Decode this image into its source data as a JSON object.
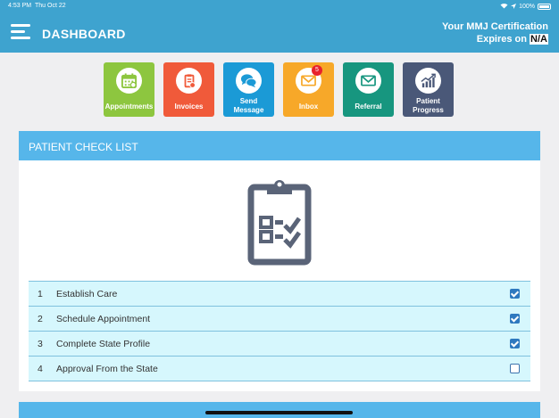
{
  "status_bar": {
    "time": "4:53 PM",
    "date": "Thu Oct 22",
    "battery": "100%"
  },
  "header": {
    "title": "DASHBOARD",
    "cert_line1": "Your MMJ Certification",
    "cert_prefix": "Expires on",
    "cert_value": "N/A"
  },
  "tiles": [
    {
      "label": "Appointments",
      "color": "#8dc63f",
      "icon": "calendar-icon"
    },
    {
      "label": "Invoices",
      "color": "#f05a3a",
      "icon": "invoice-icon"
    },
    {
      "label_line1": "Send",
      "label_line2": "Message",
      "color": "#1b9ad6",
      "icon": "chat-bubbles-icon"
    },
    {
      "label": "Inbox",
      "color": "#f7a829",
      "icon": "envelope-icon",
      "badge": "5"
    },
    {
      "label": "Referral",
      "color": "#17967f",
      "icon": "envelope-icon"
    },
    {
      "label_line1": "Patient",
      "label_line2": "Progress",
      "color": "#4a5878",
      "icon": "trend-chart-icon"
    }
  ],
  "checklist": {
    "title": "PATIENT CHECK LIST",
    "items": [
      {
        "num": "1",
        "label": "Establish Care",
        "checked": true
      },
      {
        "num": "2",
        "label": "Schedule Appointment",
        "checked": true
      },
      {
        "num": "3",
        "label": "Complete State Profile",
        "checked": true
      },
      {
        "num": "4",
        "label": "Approval From the State",
        "checked": false
      }
    ]
  },
  "colors": {
    "header": "#3ea3cf",
    "card_header": "#56b6ea",
    "row_bg": "#d6f7fd",
    "checkbox": "#2f79bf",
    "clipboard": "#5a6478"
  }
}
